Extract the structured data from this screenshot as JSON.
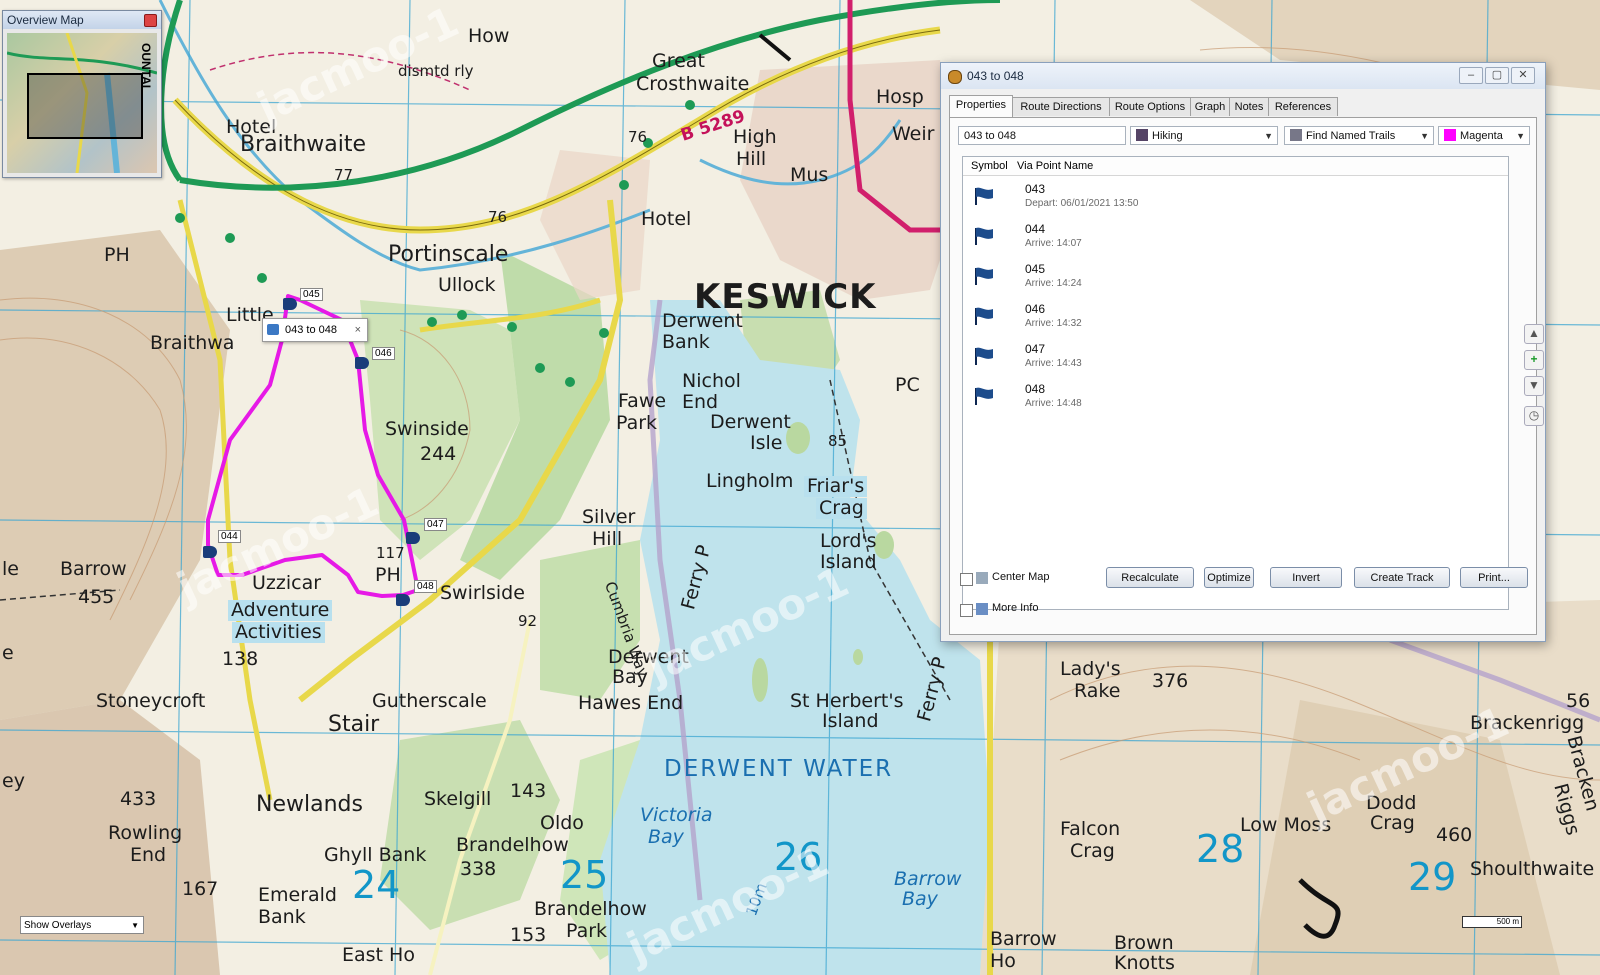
{
  "overview": {
    "title": "Overview Map",
    "side_letters": "OUNTAI"
  },
  "map_labels": {
    "how": "How",
    "dismtd_rly": "dismtd rly",
    "great": "Great",
    "crosthwaite": "Crosthwaite",
    "hotel_top": "Hotel",
    "braithwaite": "Braithwaite",
    "n77": "77",
    "n76a": "76",
    "n76b": "76",
    "b5289": "B 5289",
    "high": "High",
    "hill": "Hill",
    "hotel_mid": "Hotel",
    "hosp": "Hosp",
    "weir": "Weir",
    "mus": "Mus",
    "ph_left": "PH",
    "portinscale": "Portinscale",
    "ullock": "Ullock",
    "keswick": "KESWICK",
    "little": "Little",
    "braithwaite_small": "Braithwa",
    "derwent_bank_1": "Derwent",
    "derwent_bank_2": "Bank",
    "nichol": "Nichol",
    "end": "End",
    "fawe": "Fawe",
    "park": "Park",
    "derwent_isle_1": "Derwent",
    "derwent_isle_2": "Isle",
    "swinside": "Swinside",
    "n244": "244",
    "n85": "85",
    "pc": "PC",
    "lingholm": "Lingholm",
    "friars": "Friar's",
    "crag": "Crag",
    "silver": "Silver",
    "hill2": "Hill",
    "lords": "Lord's",
    "island": "Island",
    "barrow": "Barrow",
    "n455": "455",
    "uzzicar": "Uzzicar",
    "adventure": "Adventure",
    "activities": "Activities",
    "ph_mid": "PH",
    "n117": "117",
    "swirlside": "Swirlside",
    "n92": "92",
    "cumbria_way": "Cumbria Way",
    "ferry_p": "Ferry P",
    "n138": "138",
    "derwent_bay_1": "Derwent",
    "derwent_bay_2": "Bay",
    "hawes_end": "Hawes End",
    "stoneycroft": "Stoneycroft",
    "gutherscale": "Gutherscale",
    "stair": "Stair",
    "st_herberts": "St Herbert's",
    "island2": "Island",
    "ferry_p2": "Ferry P",
    "ladys": "Lady's",
    "rake": "Rake",
    "n376": "376",
    "n56": "56",
    "brackenrigg": "Brackenrigg",
    "derwent_water": "DERWENT  WATER",
    "ey": "ey",
    "n433": "433",
    "newlands": "Newlands",
    "skelgill": "Skelgill",
    "n143": "143",
    "oldo": "Oldo",
    "victoria": "Victoria",
    "bay": "Bay",
    "rowling": "Rowling",
    "end2": "End",
    "ghyll_bank": "Ghyll Bank",
    "brandelhow": "Brandelhow",
    "n338": "338",
    "falcon": "Falcon",
    "crag2": "Crag",
    "low_moss": "Low Moss",
    "dodd": "Dodd",
    "crag3": "Crag",
    "n460": "460",
    "shoulthwaite": "Shoulthwaite",
    "bracken": "Bracken",
    "riggs": "Riggs",
    "n167": "167",
    "emerald": "Emerald",
    "bank": "Bank",
    "g24": "24",
    "g25": "25",
    "g26": "26",
    "g28": "28",
    "g29": "29",
    "brandelhow2": "Brandelhow",
    "park2": "Park",
    "n153": "153",
    "barrow_bay_1": "Barrow",
    "barrow_bay_2": "Bay",
    "barrow2": "Barrow",
    "ho": "Ho",
    "brown": "Brown",
    "knotts": "Knotts",
    "east_ho": "East Ho",
    "ten_m": "10m",
    "le": "le",
    "n_e": "e"
  },
  "waypoint_labels": [
    "045",
    "046",
    "044",
    "047",
    "048"
  ],
  "watermark": "jacmoo-1",
  "route_popup": {
    "label": "043 to 048",
    "close": "×"
  },
  "show_overlays": {
    "label": "Show Overlays"
  },
  "scale_bar": {
    "label": "500 m"
  },
  "dialog": {
    "title": "043 to 048",
    "tabs": [
      "Properties",
      "Route Directions",
      "Route Options",
      "Graph",
      "Notes",
      "References"
    ],
    "route_name": "043 to 048",
    "activity": "Hiking",
    "trail_mode": "Find Named Trails",
    "color": "Magenta",
    "color_hex": "#ff00ff",
    "columns": {
      "symbol": "Symbol",
      "via_point_name": "Via Point Name"
    },
    "via_points": [
      {
        "name": "043",
        "time": "Depart: 06/01/2021 13:50"
      },
      {
        "name": "044",
        "time": "Arrive: 14:07"
      },
      {
        "name": "045",
        "time": "Arrive: 14:24"
      },
      {
        "name": "046",
        "time": "Arrive: 14:32"
      },
      {
        "name": "047",
        "time": "Arrive: 14:43"
      },
      {
        "name": "048",
        "time": "Arrive: 14:48"
      }
    ],
    "center_map": "Center Map",
    "more_info": "More Info",
    "buttons": {
      "recalculate": "Recalculate",
      "optimize": "Optimize",
      "invert": "Invert",
      "create_track": "Create Track",
      "print": "Print..."
    },
    "side_buttons": {
      "up": "▲",
      "add": "+",
      "down": "▼",
      "clock": "◷"
    }
  }
}
